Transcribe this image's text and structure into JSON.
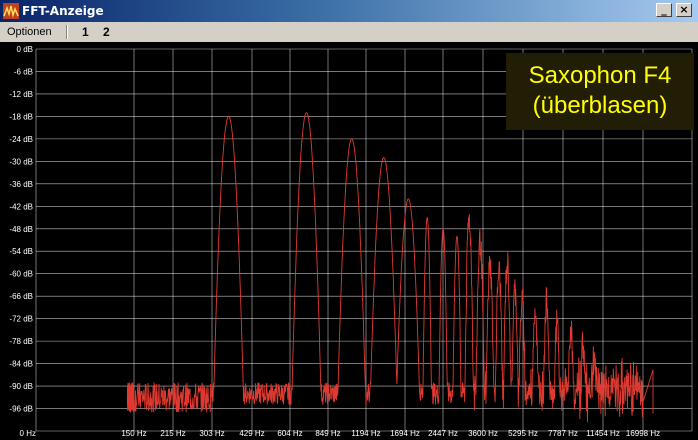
{
  "window": {
    "title": "FFT-Anzeige",
    "minimize_glyph": "_",
    "close_glyph": "×",
    "icon": "waveform-app-icon"
  },
  "menu": {
    "options_label": "Optionen",
    "button_1": "1",
    "button_2": "2"
  },
  "annotation": {
    "line1": "Saxophon F4",
    "line2": "(überblasen)"
  },
  "colors": {
    "background": "#000000",
    "grid": "#ffffff",
    "spectrum": "#e03a30",
    "annotation_text": "#ffff00"
  },
  "chart_data": {
    "type": "line",
    "title": "",
    "xlabel": "",
    "ylabel": "",
    "x_scale": "log",
    "grid": true,
    "ylim": [
      -102,
      0
    ],
    "y_tick_labels": [
      "0 dB",
      "-6 dB",
      "-12 dB",
      "-18 dB",
      "-24 dB",
      "-30 dB",
      "-36 dB",
      "-42 dB",
      "-48 dB",
      "-54 dB",
      "-60 dB",
      "-66 dB",
      "-72 dB",
      "-78 dB",
      "-84 dB",
      "-90 dB",
      "-96 dB"
    ],
    "x_tick_labels": [
      "0 Hz",
      "150 Hz",
      "215 Hz",
      "303 Hz",
      "429 Hz",
      "604 Hz",
      "849 Hz",
      "1194 Hz",
      "1694 Hz",
      "2447 Hz",
      "3600 Hz",
      "5295 Hz",
      "7787 Hz",
      "11454 Hz",
      "16998 Hz"
    ],
    "series": [
      {
        "peaks": [
          {
            "x": 350,
            "y": -18
          },
          {
            "x": 700,
            "y": -17
          },
          {
            "x": 1050,
            "y": -24
          },
          {
            "x": 1400,
            "y": -29
          },
          {
            "x": 1750,
            "y": -40
          },
          {
            "x": 2100,
            "y": -45
          },
          {
            "x": 2450,
            "y": -48
          },
          {
            "x": 2800,
            "y": -50
          },
          {
            "x": 3150,
            "y": -46
          },
          {
            "x": 3500,
            "y": -52
          },
          {
            "x": 3850,
            "y": -58
          },
          {
            "x": 4200,
            "y": -60
          },
          {
            "x": 4550,
            "y": -58
          },
          {
            "x": 4900,
            "y": -65
          },
          {
            "x": 5250,
            "y": -68
          },
          {
            "x": 5950,
            "y": -70
          },
          {
            "x": 6650,
            "y": -68
          },
          {
            "x": 7350,
            "y": -74
          },
          {
            "x": 8400,
            "y": -76
          },
          {
            "x": 9450,
            "y": -80
          },
          {
            "x": 10500,
            "y": -82
          }
        ],
        "noise_floor_db": -92
      }
    ]
  }
}
